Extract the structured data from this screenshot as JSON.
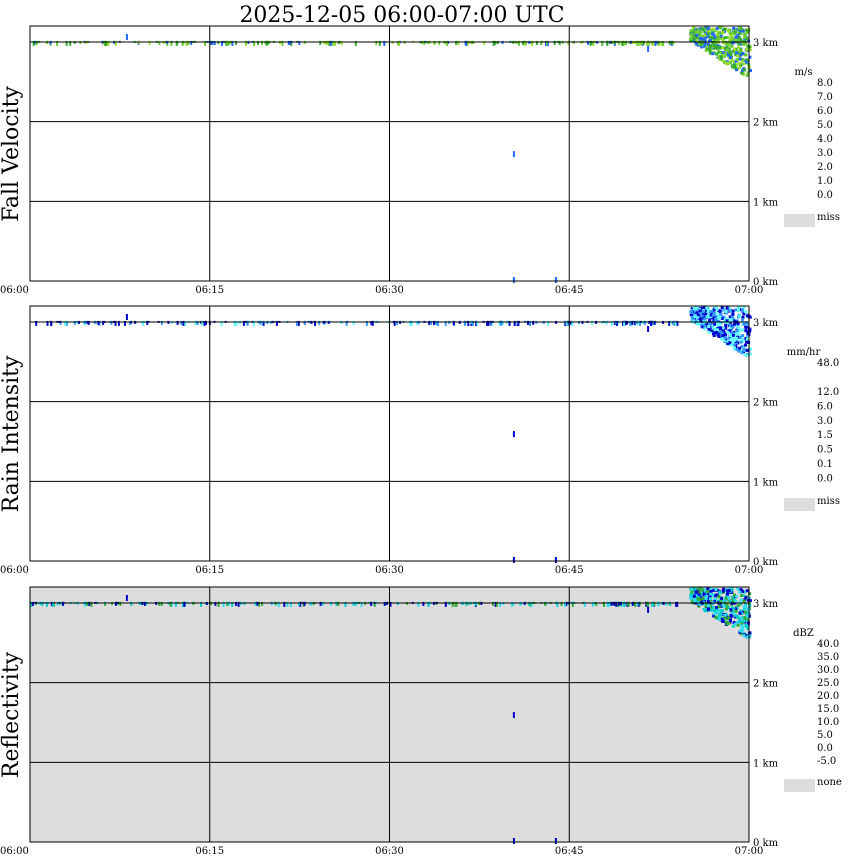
{
  "title": "2025-12-05   06:00-07:00 UTC",
  "x_ticks": [
    "06:00",
    "06:15",
    "06:30",
    "06:45",
    "07:00"
  ],
  "y_ticks": [
    "0 km",
    "1 km",
    "2 km",
    "3 km"
  ],
  "chart_data": [
    {
      "type": "heatmap",
      "panel": "Fall Velocity",
      "ylabel": "Fall Velocity",
      "xlim": [
        "06:00",
        "07:00"
      ],
      "ylim_km": [
        0,
        3.2
      ],
      "missing_color": "#ffffff",
      "grid": true,
      "colorbar": {
        "unit": "m/s",
        "labels": [
          "8.0",
          "7.0",
          "6.0",
          "5.0",
          "4.0",
          "3.0",
          "2.0",
          "1.0",
          "0.0"
        ],
        "colors": [
          "#ff00ff",
          "#ff0000",
          "#ff6600",
          "#ffcc00",
          "#99ff00",
          "#00bb00",
          "#00ffcc",
          "#00aaff",
          "#0033ff"
        ],
        "miss_label": "miss",
        "miss_color": "#dddddd"
      },
      "dominant_color": "#33aa33",
      "cell_colors": [
        "#33aa33",
        "#66cc33",
        "#99dd33",
        "#2266ff"
      ],
      "features": [
        {
          "name": "surface-clutter-band",
          "time_start_min": 0,
          "time_end_min": 52,
          "height_km": 3.0
        },
        {
          "name": "echo-top",
          "time_start_min": 55,
          "time_end_min": 60,
          "height_top_km": 3.2,
          "height_bottom_km": 2.55
        }
      ]
    },
    {
      "type": "heatmap",
      "panel": "Rain Intensity",
      "ylabel": "Rain Intensity",
      "xlim": [
        "06:00",
        "07:00"
      ],
      "ylim_km": [
        0,
        3.2
      ],
      "missing_color": "#ffffff",
      "grid": true,
      "colorbar": {
        "unit": "mm/hr",
        "labels": [
          "48.0",
          "",
          "12.0",
          "6.0",
          "3.0",
          "1.5",
          "0.5",
          "0.1",
          "0.0"
        ],
        "colors": [
          "#000000",
          "#660066",
          "#aa00aa",
          "#ff00ff",
          "#ff0000",
          "#ff6600",
          "#ffcc00",
          "#99ff33",
          "#33cc33",
          "#0000ff",
          "#3399ff",
          "#66ffff",
          "#ffffff"
        ],
        "miss_label": "miss",
        "miss_color": "#dddddd"
      },
      "dominant_color": "#66ffff",
      "cell_colors": [
        "#66ffff",
        "#3399ff",
        "#0000cc"
      ],
      "features": [
        {
          "name": "surface-clutter-band",
          "time_start_min": 0,
          "time_end_min": 52,
          "height_km": 3.0
        },
        {
          "name": "echo-top",
          "time_start_min": 55,
          "time_end_min": 60,
          "height_top_km": 3.2,
          "height_bottom_km": 2.55
        }
      ]
    },
    {
      "type": "heatmap",
      "panel": "Reflectivity",
      "ylabel": "Reflectivity",
      "xlim": [
        "06:00",
        "07:00"
      ],
      "ylim_km": [
        0,
        3.2
      ],
      "missing_color": "#dddddd",
      "grid": true,
      "colorbar": {
        "unit": "dBZ",
        "labels": [
          "40.0",
          "35.0",
          "30.0",
          "25.0",
          "20.0",
          "15.0",
          "10.0",
          "5.0",
          "0.0",
          "-5.0"
        ],
        "colors": [
          "#aa55aa",
          "#ff00ff",
          "#aa00aa",
          "#ff0000",
          "#ff6600",
          "#ffff00",
          "#00bb00",
          "#00ffff",
          "#00aaff",
          "#0000cc"
        ],
        "miss_label": "none",
        "miss_color": "#dddddd"
      },
      "dominant_color": "#33ddee",
      "cell_colors": [
        "#33ddee",
        "#00cccc",
        "#33aa33",
        "#0000cc"
      ],
      "features": [
        {
          "name": "surface-clutter-band",
          "time_start_min": 0,
          "time_end_min": 52,
          "height_km": 3.0
        },
        {
          "name": "echo-top",
          "time_start_min": 55,
          "time_end_min": 60,
          "height_top_km": 3.2,
          "height_bottom_km": 2.55
        }
      ]
    }
  ]
}
